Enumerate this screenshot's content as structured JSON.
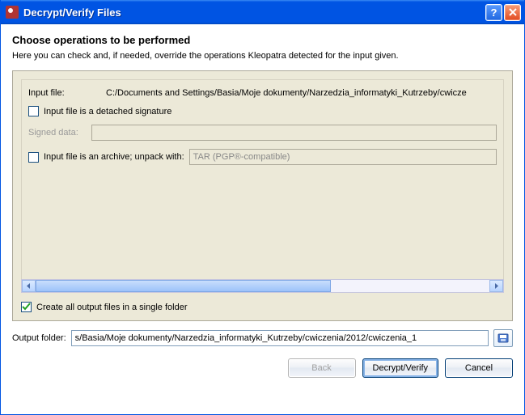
{
  "window": {
    "title": "Decrypt/Verify Files"
  },
  "heading": "Choose operations to be performed",
  "subtext": "Here you can check and, if needed, override the operations Kleopatra detected for the input given.",
  "inputFile": {
    "label": "Input file:",
    "path": "C:/Documents and Settings/Basia/Moje dokumenty/Narzedzia_informatyki_Kutrzeby/cwicze"
  },
  "detachedSig": {
    "label": "Input file is a detached signature",
    "checked": false
  },
  "signedData": {
    "label": "Signed data:",
    "value": ""
  },
  "archive": {
    "label": "Input file is an archive; unpack with:",
    "checked": false,
    "method": "TAR (PGP®-compatible)"
  },
  "createSingleFolder": {
    "label": "Create all output files in a single folder",
    "checked": true
  },
  "outputFolder": {
    "label": "Output folder:",
    "value": "s/Basia/Moje dokumenty/Narzedzia_informatyki_Kutrzeby/cwiczenia/2012/cwiczenia_1"
  },
  "buttons": {
    "back": "Back",
    "decrypt": "Decrypt/Verify",
    "cancel": "Cancel"
  }
}
